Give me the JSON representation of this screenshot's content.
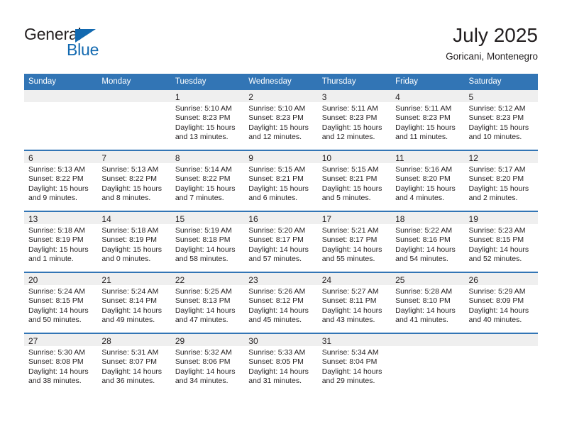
{
  "brand": {
    "name_part1": "General",
    "name_part2": "Blue",
    "triangle_color": "#1269b0",
    "text_color": "#231f20"
  },
  "header": {
    "title": "July 2025",
    "subtitle": "Goricani, Montenegro"
  },
  "theme": {
    "header_blue": "#3275b5",
    "daynum_band": "#efefef",
    "body_text": "#231f20",
    "page_background": "#ffffff"
  },
  "weekday_headers": [
    "Sunday",
    "Monday",
    "Tuesday",
    "Wednesday",
    "Thursday",
    "Friday",
    "Saturday"
  ],
  "labels": {
    "sunrise_prefix": "Sunrise:",
    "sunset_prefix": "Sunset:",
    "daylight_prefix": "Daylight:"
  },
  "weeks": [
    [
      {
        "day": "",
        "empty": true,
        "line1": "",
        "line2": "",
        "line3": "",
        "line4": ""
      },
      {
        "day": "",
        "empty": true,
        "line1": "",
        "line2": "",
        "line3": "",
        "line4": ""
      },
      {
        "day": "1",
        "line1": "Sunrise: 5:10 AM",
        "line2": "Sunset: 8:23 PM",
        "line3": "Daylight: 15 hours",
        "line4": "and 13 minutes."
      },
      {
        "day": "2",
        "line1": "Sunrise: 5:10 AM",
        "line2": "Sunset: 8:23 PM",
        "line3": "Daylight: 15 hours",
        "line4": "and 12 minutes."
      },
      {
        "day": "3",
        "line1": "Sunrise: 5:11 AM",
        "line2": "Sunset: 8:23 PM",
        "line3": "Daylight: 15 hours",
        "line4": "and 12 minutes."
      },
      {
        "day": "4",
        "line1": "Sunrise: 5:11 AM",
        "line2": "Sunset: 8:23 PM",
        "line3": "Daylight: 15 hours",
        "line4": "and 11 minutes."
      },
      {
        "day": "5",
        "line1": "Sunrise: 5:12 AM",
        "line2": "Sunset: 8:23 PM",
        "line3": "Daylight: 15 hours",
        "line4": "and 10 minutes."
      }
    ],
    [
      {
        "day": "6",
        "line1": "Sunrise: 5:13 AM",
        "line2": "Sunset: 8:22 PM",
        "line3": "Daylight: 15 hours",
        "line4": "and 9 minutes."
      },
      {
        "day": "7",
        "line1": "Sunrise: 5:13 AM",
        "line2": "Sunset: 8:22 PM",
        "line3": "Daylight: 15 hours",
        "line4": "and 8 minutes."
      },
      {
        "day": "8",
        "line1": "Sunrise: 5:14 AM",
        "line2": "Sunset: 8:22 PM",
        "line3": "Daylight: 15 hours",
        "line4": "and 7 minutes."
      },
      {
        "day": "9",
        "line1": "Sunrise: 5:15 AM",
        "line2": "Sunset: 8:21 PM",
        "line3": "Daylight: 15 hours",
        "line4": "and 6 minutes."
      },
      {
        "day": "10",
        "line1": "Sunrise: 5:15 AM",
        "line2": "Sunset: 8:21 PM",
        "line3": "Daylight: 15 hours",
        "line4": "and 5 minutes."
      },
      {
        "day": "11",
        "line1": "Sunrise: 5:16 AM",
        "line2": "Sunset: 8:20 PM",
        "line3": "Daylight: 15 hours",
        "line4": "and 4 minutes."
      },
      {
        "day": "12",
        "line1": "Sunrise: 5:17 AM",
        "line2": "Sunset: 8:20 PM",
        "line3": "Daylight: 15 hours",
        "line4": "and 2 minutes."
      }
    ],
    [
      {
        "day": "13",
        "line1": "Sunrise: 5:18 AM",
        "line2": "Sunset: 8:19 PM",
        "line3": "Daylight: 15 hours",
        "line4": "and 1 minute."
      },
      {
        "day": "14",
        "line1": "Sunrise: 5:18 AM",
        "line2": "Sunset: 8:19 PM",
        "line3": "Daylight: 15 hours",
        "line4": "and 0 minutes."
      },
      {
        "day": "15",
        "line1": "Sunrise: 5:19 AM",
        "line2": "Sunset: 8:18 PM",
        "line3": "Daylight: 14 hours",
        "line4": "and 58 minutes."
      },
      {
        "day": "16",
        "line1": "Sunrise: 5:20 AM",
        "line2": "Sunset: 8:17 PM",
        "line3": "Daylight: 14 hours",
        "line4": "and 57 minutes."
      },
      {
        "day": "17",
        "line1": "Sunrise: 5:21 AM",
        "line2": "Sunset: 8:17 PM",
        "line3": "Daylight: 14 hours",
        "line4": "and 55 minutes."
      },
      {
        "day": "18",
        "line1": "Sunrise: 5:22 AM",
        "line2": "Sunset: 8:16 PM",
        "line3": "Daylight: 14 hours",
        "line4": "and 54 minutes."
      },
      {
        "day": "19",
        "line1": "Sunrise: 5:23 AM",
        "line2": "Sunset: 8:15 PM",
        "line3": "Daylight: 14 hours",
        "line4": "and 52 minutes."
      }
    ],
    [
      {
        "day": "20",
        "line1": "Sunrise: 5:24 AM",
        "line2": "Sunset: 8:15 PM",
        "line3": "Daylight: 14 hours",
        "line4": "and 50 minutes."
      },
      {
        "day": "21",
        "line1": "Sunrise: 5:24 AM",
        "line2": "Sunset: 8:14 PM",
        "line3": "Daylight: 14 hours",
        "line4": "and 49 minutes."
      },
      {
        "day": "22",
        "line1": "Sunrise: 5:25 AM",
        "line2": "Sunset: 8:13 PM",
        "line3": "Daylight: 14 hours",
        "line4": "and 47 minutes."
      },
      {
        "day": "23",
        "line1": "Sunrise: 5:26 AM",
        "line2": "Sunset: 8:12 PM",
        "line3": "Daylight: 14 hours",
        "line4": "and 45 minutes."
      },
      {
        "day": "24",
        "line1": "Sunrise: 5:27 AM",
        "line2": "Sunset: 8:11 PM",
        "line3": "Daylight: 14 hours",
        "line4": "and 43 minutes."
      },
      {
        "day": "25",
        "line1": "Sunrise: 5:28 AM",
        "line2": "Sunset: 8:10 PM",
        "line3": "Daylight: 14 hours",
        "line4": "and 41 minutes."
      },
      {
        "day": "26",
        "line1": "Sunrise: 5:29 AM",
        "line2": "Sunset: 8:09 PM",
        "line3": "Daylight: 14 hours",
        "line4": "and 40 minutes."
      }
    ],
    [
      {
        "day": "27",
        "line1": "Sunrise: 5:30 AM",
        "line2": "Sunset: 8:08 PM",
        "line3": "Daylight: 14 hours",
        "line4": "and 38 minutes."
      },
      {
        "day": "28",
        "line1": "Sunrise: 5:31 AM",
        "line2": "Sunset: 8:07 PM",
        "line3": "Daylight: 14 hours",
        "line4": "and 36 minutes."
      },
      {
        "day": "29",
        "line1": "Sunrise: 5:32 AM",
        "line2": "Sunset: 8:06 PM",
        "line3": "Daylight: 14 hours",
        "line4": "and 34 minutes."
      },
      {
        "day": "30",
        "line1": "Sunrise: 5:33 AM",
        "line2": "Sunset: 8:05 PM",
        "line3": "Daylight: 14 hours",
        "line4": "and 31 minutes."
      },
      {
        "day": "31",
        "line1": "Sunrise: 5:34 AM",
        "line2": "Sunset: 8:04 PM",
        "line3": "Daylight: 14 hours",
        "line4": "and 29 minutes."
      },
      {
        "day": "",
        "empty": true,
        "line1": "",
        "line2": "",
        "line3": "",
        "line4": ""
      },
      {
        "day": "",
        "empty": true,
        "line1": "",
        "line2": "",
        "line3": "",
        "line4": ""
      }
    ]
  ]
}
